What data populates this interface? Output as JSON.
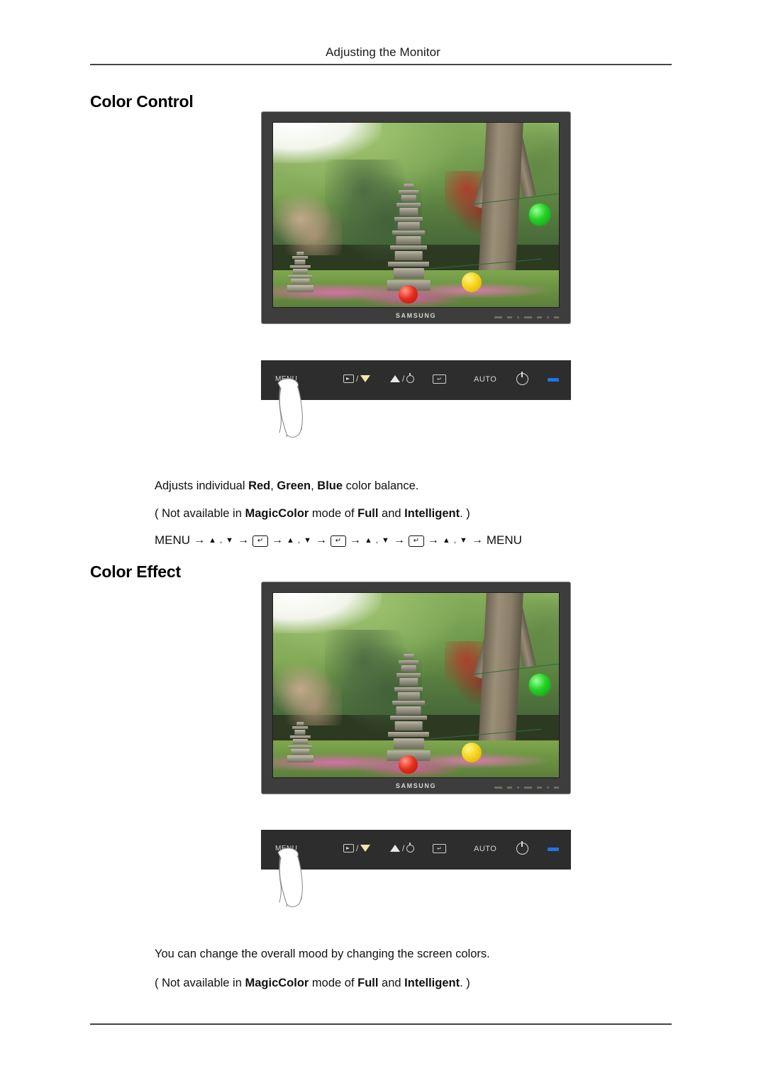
{
  "header": {
    "title": "Adjusting the Monitor"
  },
  "sections": [
    {
      "heading": "Color Control",
      "monitor": {
        "brand": "SAMSUNG",
        "scene_description": "Korean garden with stone pagoda, trees and paper lanterns"
      },
      "control_panel": {
        "menu_label": "MENU",
        "source_label": "SOURCE",
        "auto_label": "AUTO",
        "enter_glyph": "↵",
        "down_glyph": "▼",
        "up_glyph": "▲",
        "power_glyph": "power-symbol",
        "led_color": "#1e74e8",
        "pressed_button": "MENU"
      },
      "description_1_pre": "Adjusts individual ",
      "description_1_b1": "Red",
      "description_1_mid1": ", ",
      "description_1_b2": "Green",
      "description_1_mid2": ", ",
      "description_1_b3": "Blue",
      "description_1_post": " color balance.",
      "note_pre": "( Not available in ",
      "note_b1": "MagicColor",
      "note_mid": " mode of ",
      "note_b2": "Full",
      "note_and": " and ",
      "note_b3": "Intelligent",
      "note_post": ". )",
      "path": {
        "start": "MENU",
        "arrow": "→",
        "updown": "▲ , ▼",
        "key": "↵",
        "end": "MENU"
      }
    },
    {
      "heading": "Color Effect",
      "monitor": {
        "brand": "SAMSUNG",
        "scene_description": "Korean garden with stone pagoda, trees and paper lanterns"
      },
      "control_panel": {
        "menu_label": "MENU",
        "source_label": "SOURCE",
        "auto_label": "AUTO",
        "enter_glyph": "↵",
        "down_glyph": "▼",
        "up_glyph": "▲",
        "power_glyph": "power-symbol",
        "led_color": "#1e74e8",
        "pressed_button": "MENU"
      },
      "description_1": "You can change the overall mood by changing the screen colors.",
      "note_pre": "( Not available in ",
      "note_b1": "MagicColor",
      "note_mid": " mode of ",
      "note_b2": "Full",
      "note_and": " and ",
      "note_b3": "Intelligent",
      "note_post": ". )"
    }
  ]
}
